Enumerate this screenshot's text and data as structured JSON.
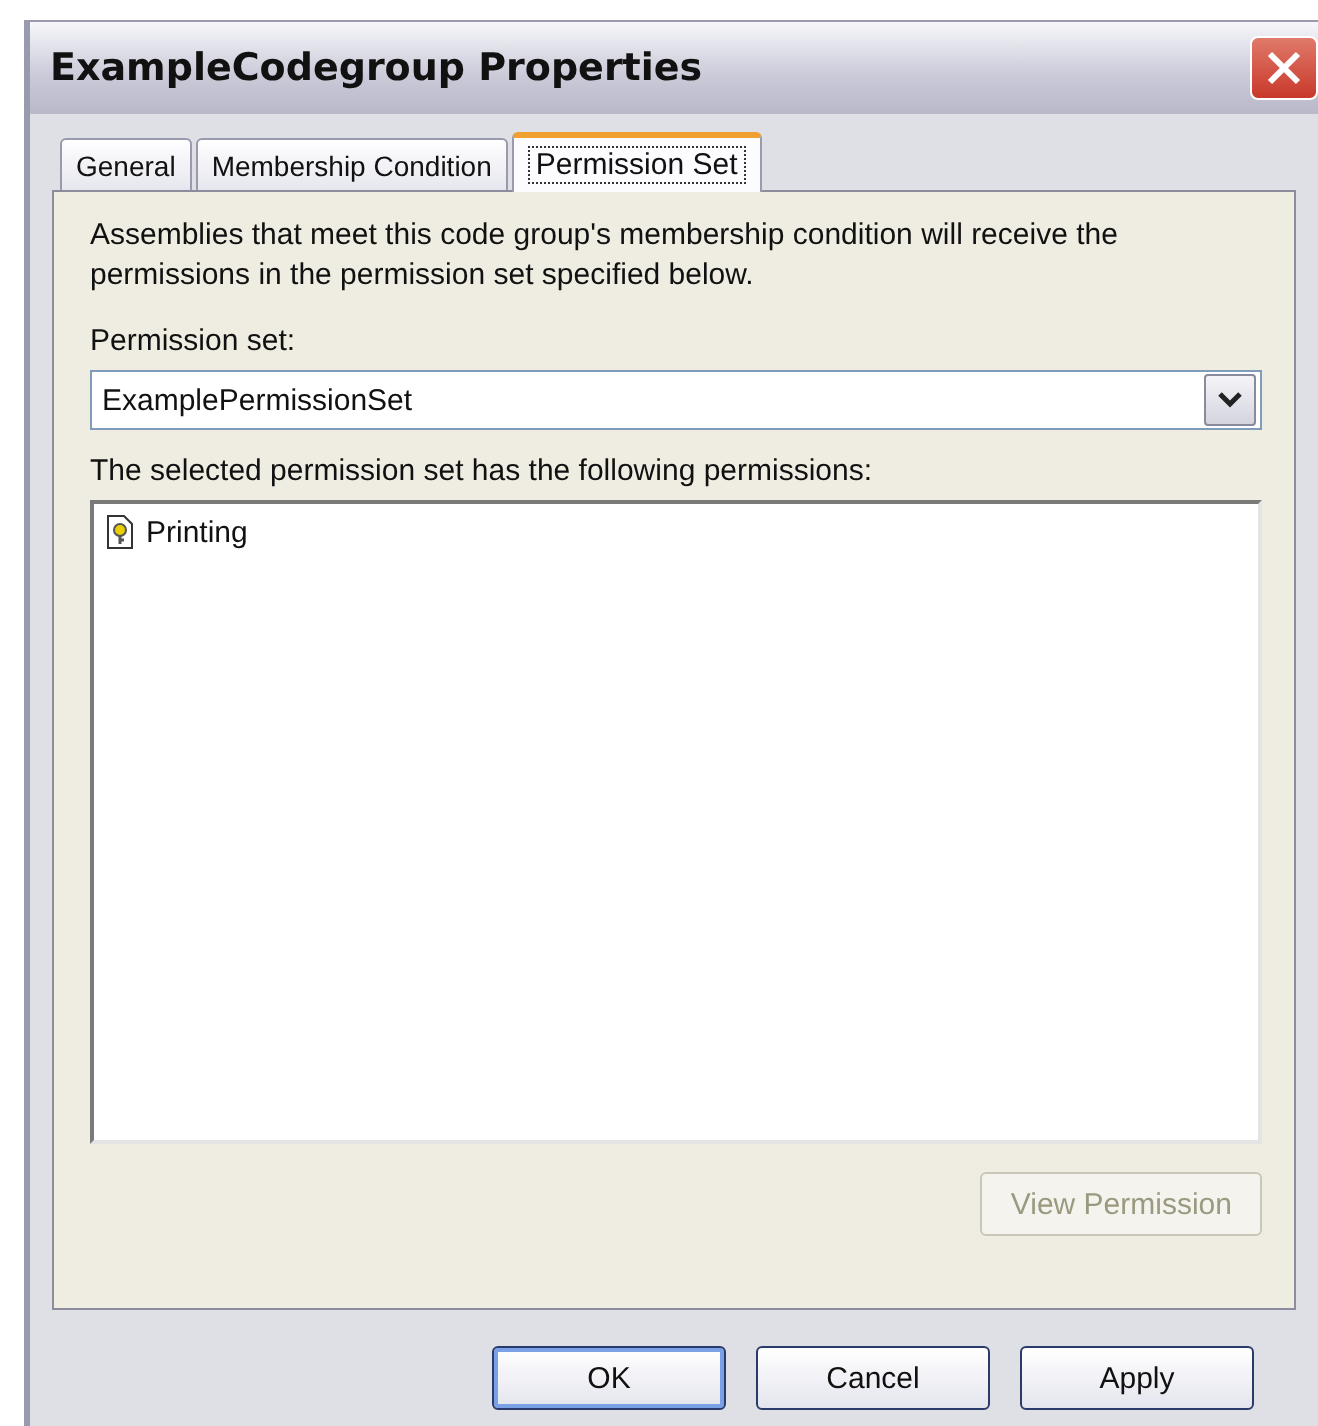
{
  "window": {
    "title": "ExampleCodegroup Properties"
  },
  "tabs": [
    {
      "label": "General",
      "selected": false
    },
    {
      "label": "Membership Condition",
      "selected": false
    },
    {
      "label": "Permission Set",
      "selected": true
    }
  ],
  "description": "Assemblies that meet this code group's membership condition will receive the permissions in the permission set specified below.",
  "permission_set": {
    "label": "Permission set:",
    "value": "ExamplePermissionSet"
  },
  "permissions": {
    "label": "The selected permission set has the following permissions:",
    "items": [
      {
        "name": "Printing",
        "selected": false
      }
    ]
  },
  "view_button": {
    "label": "View Permission",
    "disabled": true
  },
  "buttons": [
    {
      "label": "OK",
      "default": true
    },
    {
      "label": "Cancel",
      "default": false
    },
    {
      "label": "Apply",
      "default": false
    }
  ]
}
